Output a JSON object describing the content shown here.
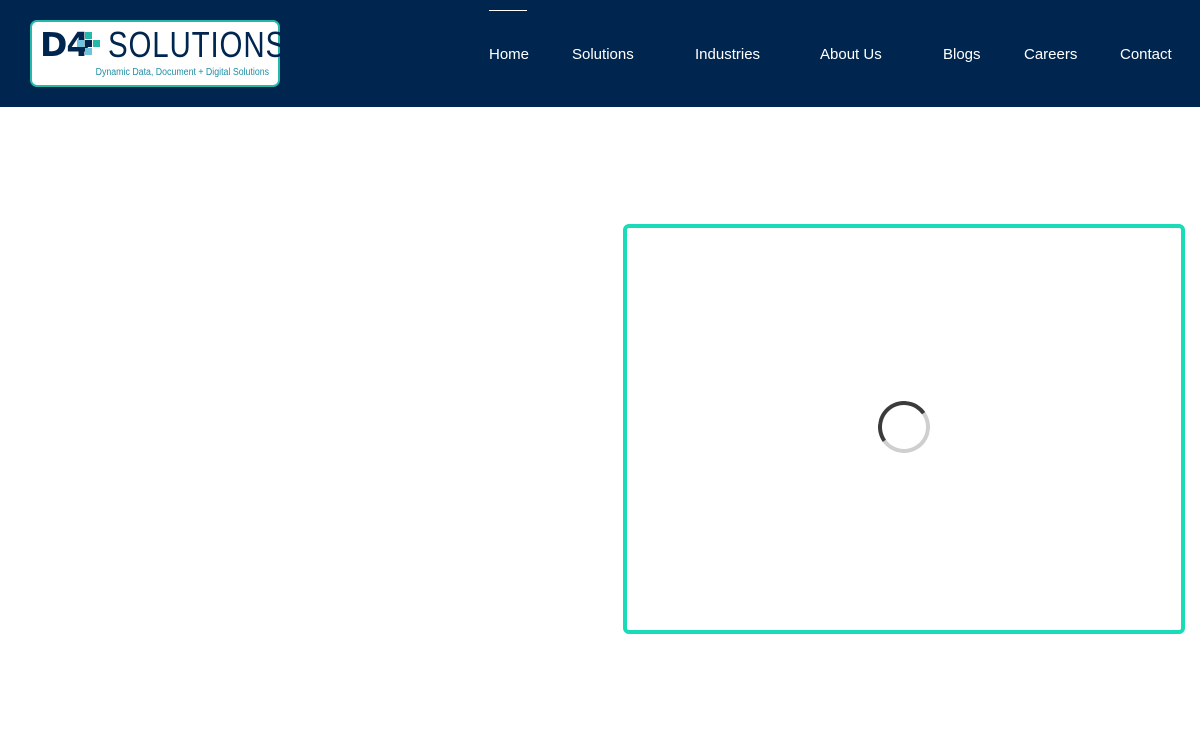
{
  "logo": {
    "mark": "D4",
    "word": "SOLUTIONS",
    "tagline": "Dynamic Data, Document + Digital Solutions",
    "colors": {
      "navy": "#00264f",
      "teal": "#25b9a9",
      "light_blue": "#6fc3dd"
    }
  },
  "header": {
    "background": "#00264f"
  },
  "nav": {
    "items": [
      {
        "label": "Home",
        "active": true
      },
      {
        "label": "Solutions"
      },
      {
        "label": "Industries"
      },
      {
        "label": "About Us"
      },
      {
        "label": "Blogs"
      },
      {
        "label": "Careers"
      },
      {
        "label": "Contact"
      }
    ]
  },
  "media": {
    "state": "loading",
    "border_color": "#19dbb7",
    "spinner_icon": "loading-spinner-icon"
  }
}
